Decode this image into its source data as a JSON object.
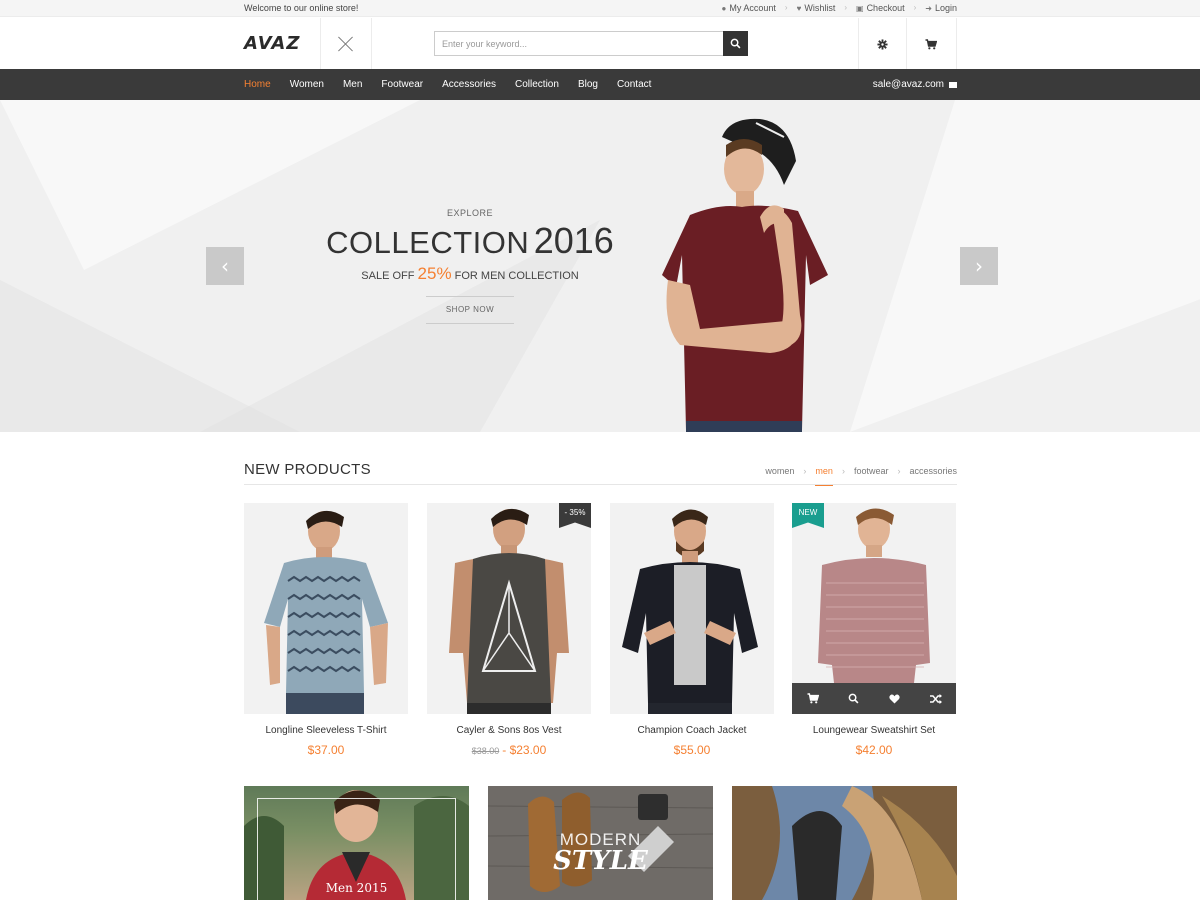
{
  "topbar": {
    "welcome": "Welcome to our online store!",
    "links": [
      {
        "label": "My Account",
        "icon": "user-icon"
      },
      {
        "label": "Wishlist",
        "icon": "heart-icon"
      },
      {
        "label": "Checkout",
        "icon": "checkout-icon"
      },
      {
        "label": "Login",
        "icon": "login-icon"
      }
    ]
  },
  "header": {
    "logo": "AVAZ",
    "search_placeholder": "Enter your keyword...",
    "icons": [
      "close-icon",
      "search-icon",
      "gear-icon",
      "cart-icon"
    ]
  },
  "nav": {
    "items": [
      "Home",
      "Women",
      "Men",
      "Footwear",
      "Accessories",
      "Collection",
      "Blog",
      "Contact"
    ],
    "active": "Home",
    "email": "sale@avaz.com"
  },
  "hero": {
    "explore": "EXPLORE",
    "title_word": "COLLECTION",
    "title_year": "2016",
    "sale_prefix": "SALE OFF",
    "sale_pct": "25%",
    "sale_suffix": "FOR MEN COLLECTION",
    "button": "SHOP NOW"
  },
  "new_products": {
    "title": "NEW PRODUCTS",
    "filters": [
      "women",
      "men",
      "footwear",
      "accessories"
    ],
    "active_filter": "men",
    "items": [
      {
        "name": "Longline Sleeveless T-Shirt",
        "price": "$37.00"
      },
      {
        "name": "Cayler & Sons 8os Vest",
        "old_price": "$38.00",
        "separator": "-",
        "price": "$23.00",
        "badge": "- 35%"
      },
      {
        "name": "Champion Coach Jacket",
        "price": "$55.00"
      },
      {
        "name": "Loungewear Sweatshirt Set",
        "price": "$42.00",
        "badge": "NEW"
      }
    ]
  },
  "banners": {
    "b1": "Men 2015",
    "b2_top": "MODERN",
    "b2_bottom": "STYLE"
  },
  "colors": {
    "accent": "#f58032",
    "nav_bg": "#3a3a3a",
    "badge_new": "#1a9e8f"
  }
}
